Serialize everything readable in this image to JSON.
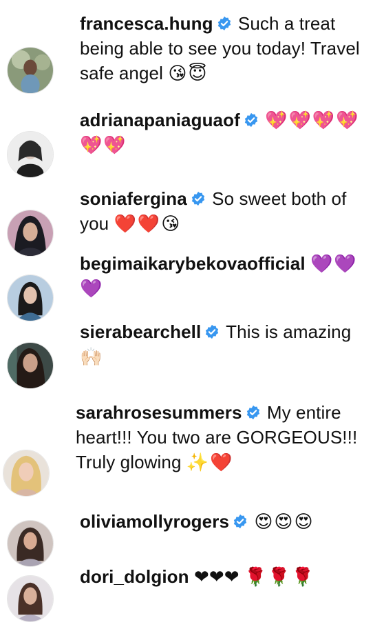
{
  "comments": [
    {
      "username": "francesca.hung",
      "verified": true,
      "text": "Such a treat being able to see you today! Travel safe angel",
      "emojis": "😘😇"
    },
    {
      "username": "adrianapaniaguaof",
      "verified": true,
      "text": "",
      "emojis": "💖💖💖💖💖💖"
    },
    {
      "username": "soniafergina",
      "verified": true,
      "text": "So sweet both of you",
      "emojis": "❤️❤️😘"
    },
    {
      "username": "begimaikarybekovaofficial",
      "verified": false,
      "text": "",
      "emojis": "💜💜💜"
    },
    {
      "username": "sierabearchell",
      "verified": true,
      "text": "This is amazing",
      "emojis": "🙌🏻"
    },
    {
      "username": "sarahrosesummers",
      "verified": true,
      "text": "My entire heart!!! You two are GORGEOUS!!! Truly glowing",
      "emojis": "✨❤️"
    },
    {
      "username": "oliviamollyrogers",
      "verified": true,
      "text": "",
      "emojis": "😍😍😍"
    },
    {
      "username": "dori_dolgion",
      "verified": false,
      "text": "❤❤❤",
      "emojis": "🌹🌹🌹"
    }
  ],
  "colors": {
    "verified_badge": "#3897f0",
    "text": "#111111"
  },
  "icons": {
    "verified": "verified-badge-icon"
  }
}
